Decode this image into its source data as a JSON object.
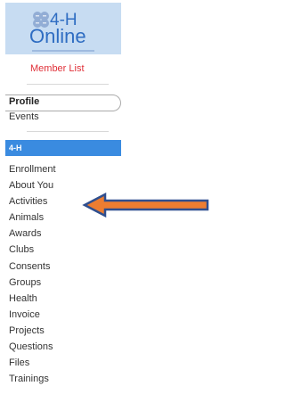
{
  "logo": {
    "brand_top": "4-H",
    "brand_bottom": "Online",
    "icon": "clover-icon"
  },
  "nav": {
    "member_list": "Member List",
    "profile": "Profile",
    "events": "Events",
    "section_title": "4-H",
    "items": [
      "Enrollment",
      "About You",
      "Activities",
      "Animals",
      "Awards",
      "Clubs",
      "Consents",
      "Groups",
      "Health",
      "Invoice",
      "Projects",
      "Questions",
      "Files",
      "Trainings"
    ]
  },
  "annotation": {
    "arrow_target": "Animals",
    "arrow_fill": "#ed7d31",
    "arrow_outline": "#2f4f8f"
  },
  "colors": {
    "accent_blue": "#3a8be0",
    "member_list_red": "#e03038",
    "logo_blue": "#2f6dc2",
    "logo_bg": "#c7dcf2"
  }
}
